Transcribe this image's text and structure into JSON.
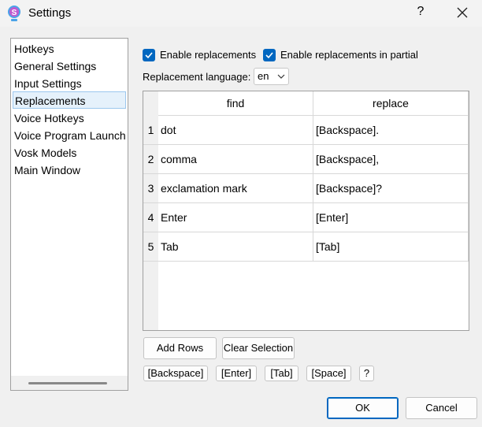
{
  "window": {
    "title": "Settings",
    "help_label": "?",
    "icon": "app-logo-icon",
    "close_icon": "close-icon"
  },
  "sidebar": {
    "items": [
      {
        "label": "Hotkeys"
      },
      {
        "label": "General Settings"
      },
      {
        "label": "Input Settings"
      },
      {
        "label": "Replacements",
        "selected": true
      },
      {
        "label": "Voice Hotkeys"
      },
      {
        "label": "Voice Program Launch"
      },
      {
        "label": "Vosk Models"
      },
      {
        "label": "Main Window"
      }
    ]
  },
  "options": {
    "enable_replacements": {
      "label": "Enable replacements",
      "checked": true
    },
    "enable_partial": {
      "label": "Enable replacements in partial",
      "checked": true
    },
    "language_label": "Replacement language:",
    "language_value": "en"
  },
  "table": {
    "columns": [
      "find",
      "replace"
    ],
    "rows": [
      {
        "num": "1",
        "find": "dot",
        "replace": "[Backspace]."
      },
      {
        "num": "2",
        "find": "comma",
        "replace": "[Backspace],"
      },
      {
        "num": "3",
        "find": "exclamation mark",
        "replace": "[Backspace]?"
      },
      {
        "num": "4",
        "find": "Enter",
        "replace": "[Enter]"
      },
      {
        "num": "5",
        "find": "Tab",
        "replace": "[Tab]"
      }
    ]
  },
  "actions": {
    "add_rows": "Add Rows",
    "clear_selection": "Clear Selection"
  },
  "tokens": [
    "[Backspace]",
    "[Enter]",
    "[Tab]",
    "[Space]",
    "?"
  ],
  "footer": {
    "ok": "OK",
    "cancel": "Cancel"
  },
  "colors": {
    "accent": "#0067c0",
    "selection": "#e5f1fb"
  }
}
